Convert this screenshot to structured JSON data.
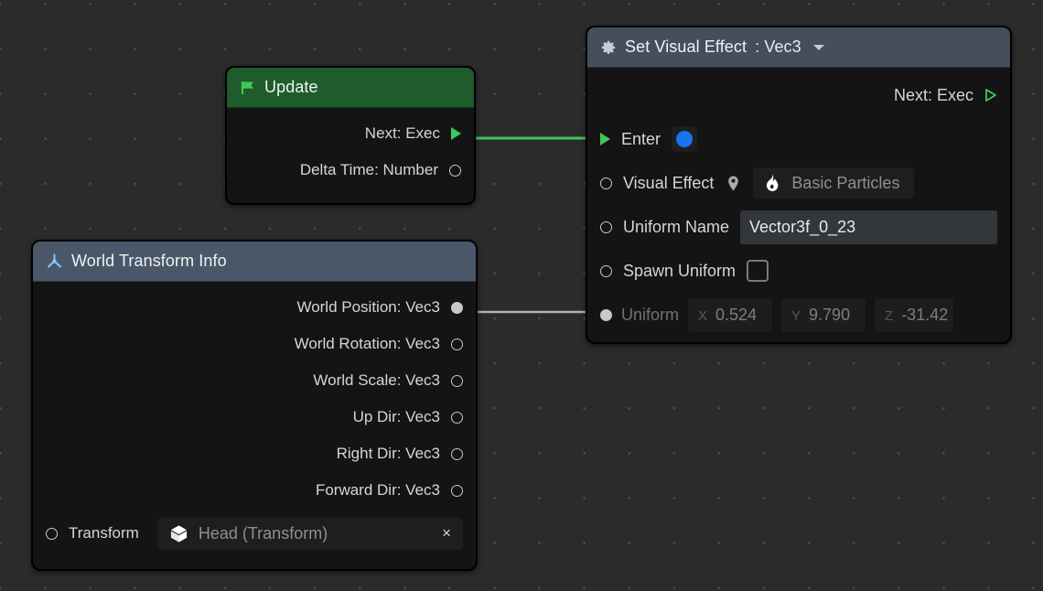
{
  "canvas": {
    "background_color": "#2b2b2b",
    "grid_dot_color": "#4a4a4a"
  },
  "nodes": [
    {
      "id": "update",
      "title": "Update",
      "header_icon": "flag-icon",
      "header_color": "#1e5c2b",
      "outputs": [
        {
          "label": "Next: Exec",
          "port": "exec-triangle",
          "connected": true
        },
        {
          "label": "Delta Time: Number",
          "port": "circle",
          "connected": false
        }
      ]
    },
    {
      "id": "world_transform_info",
      "title": "World Transform Info",
      "header_icon": "axis-tripod-icon",
      "header_color": "#495769",
      "outputs": [
        {
          "label": "World Position: Vec3",
          "port": "circle",
          "connected": true
        },
        {
          "label": "World Rotation: Vec3",
          "port": "circle",
          "connected": false
        },
        {
          "label": "World Scale: Vec3",
          "port": "circle",
          "connected": false
        },
        {
          "label": "Up Dir: Vec3",
          "port": "circle",
          "connected": false
        },
        {
          "label": "Right Dir: Vec3",
          "port": "circle",
          "connected": false
        },
        {
          "label": "Forward Dir: Vec3",
          "port": "circle",
          "connected": false
        }
      ],
      "transform_row": {
        "label": "Transform",
        "chip_icon": "cube-icon",
        "chip_value": "Head (Transform)",
        "clear_label": "×"
      }
    },
    {
      "id": "set_visual_effect",
      "title": "Set Visual Effect",
      "title_suffix": ": Vec3",
      "header_icon": "gear-icon",
      "header_color": "#474e5b",
      "dropdown_icon": "chevron-down-icon",
      "next_exec_label": "Next: Exec",
      "enter_label": "Enter",
      "visual_effect": {
        "label": "Visual Effect",
        "pin_icon": "location-pin-icon",
        "asset_icon": "flame-icon",
        "asset_name": "Basic Particles"
      },
      "uniform_name": {
        "label": "Uniform Name",
        "value": "Vector3f_0_23"
      },
      "spawn_uniform": {
        "label": "Spawn Uniform",
        "checked": false
      },
      "uniform": {
        "label": "Uniform",
        "x_axis": "X",
        "x_value": "0.524",
        "y_axis": "Y",
        "y_value": "9.790",
        "z_axis": "Z",
        "z_value": "-31.42"
      }
    }
  ],
  "connections": [
    {
      "from": "update.Next: Exec",
      "to": "set_visual_effect.Enter",
      "color": "#3fc75b"
    },
    {
      "from": "world_transform_info.World Position: Vec3",
      "to": "set_visual_effect.Uniform",
      "color": "#b0b2b5"
    }
  ]
}
